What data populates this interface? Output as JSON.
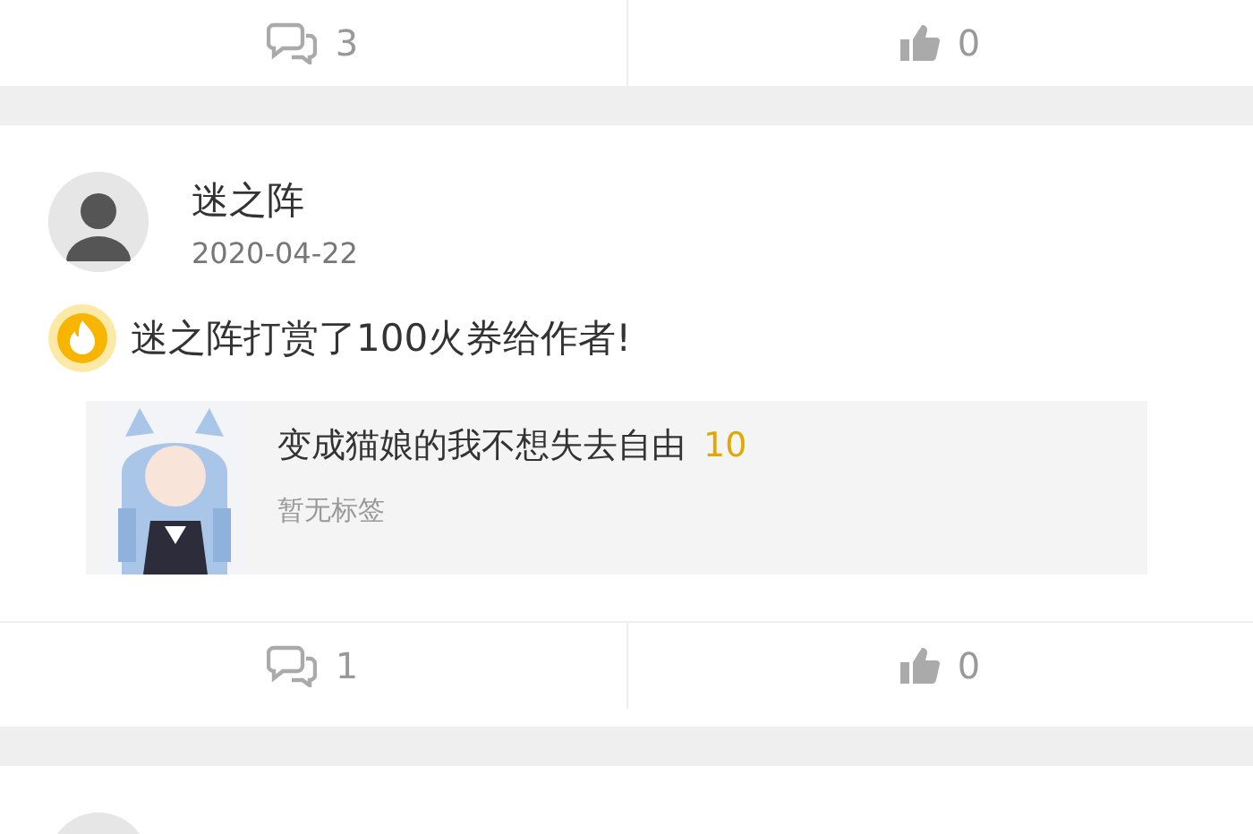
{
  "previous_post_actions": {
    "comments": "3",
    "likes": "0"
  },
  "post": {
    "author": "迷之阵",
    "date": "2020-04-22",
    "reward_text": "迷之阵打赏了100火券给作者!",
    "book": {
      "title": "变成猫娘的我不想失去自由",
      "score": "10",
      "tags": "暂无标签"
    },
    "comments": "1",
    "likes": "0"
  }
}
